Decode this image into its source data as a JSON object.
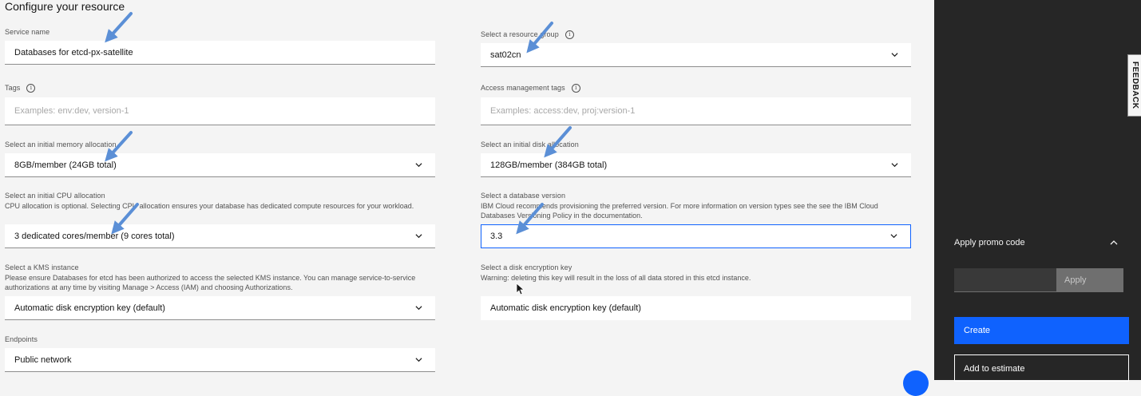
{
  "page": {
    "title": "Configure your resource"
  },
  "service_name": {
    "label": "Service name",
    "value": "Databases for etcd-px-satellite"
  },
  "resource_group": {
    "label": "Select a resource group",
    "value": "sat02cn"
  },
  "tags": {
    "label": "Tags",
    "placeholder": "Examples: env:dev, version-1"
  },
  "access_tags": {
    "label": "Access management tags",
    "placeholder": "Examples: access:dev, proj:version-1"
  },
  "memory": {
    "label": "Select an initial memory allocation",
    "value": "8GB/member (24GB total)"
  },
  "disk": {
    "label": "Select an initial disk allocation",
    "value": "128GB/member (384GB total)"
  },
  "cpu": {
    "label": "Select an initial CPU allocation",
    "help": "CPU allocation is optional. Selecting CPU allocation ensures your database has dedicated compute resources for your workload.",
    "value": "3 dedicated cores/member (9 cores total)"
  },
  "db_version": {
    "label": "Select a database version",
    "help_line1": "IBM Cloud recommends provisioning the preferred version. For more information on version types see the see the IBM Cloud",
    "help_line2": "Databases Versioning Policy in the documentation.",
    "value": "3.3"
  },
  "kms": {
    "label": "Select a KMS instance",
    "help_line1": "Please ensure Databases for etcd has been authorized to access the selected KMS instance. You can manage service-to-service",
    "help_line2": "authorizations at any time by visiting Manage > Access (IAM) and choosing Authorizations.",
    "value": "Automatic disk encryption key (default)"
  },
  "disk_key": {
    "label": "Select a disk encryption key",
    "help": "Warning: deleting this key will result in the loss of all data stored in this etcd instance.",
    "value": "Automatic disk encryption key (default)"
  },
  "endpoints": {
    "label": "Endpoints",
    "value": "Public network"
  },
  "sidebar": {
    "feedback": "FEEDBACK",
    "promo_label": "Apply promo code",
    "apply_label": "Apply",
    "create_label": "Create",
    "estimate_label": "Add to estimate"
  },
  "icons": {
    "info": "info-icon",
    "chevron": "chevron-down-icon",
    "annotation_arrow": "arrow-annotation",
    "cursor": "mouse-cursor-icon"
  },
  "colors": {
    "accent": "#0f62fe",
    "annotation_arrow": "#5b8fd6",
    "sidebar_bg": "#262626",
    "page_bg": "#f4f4f4"
  }
}
